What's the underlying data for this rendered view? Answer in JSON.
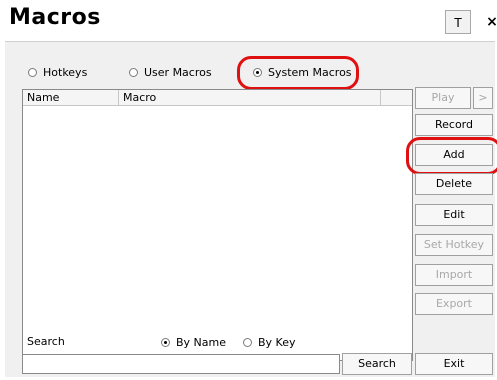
{
  "window": {
    "title": "Macros",
    "pin_label": "T",
    "close_label": "×"
  },
  "tabs": {
    "hotkeys": "Hotkeys",
    "user_macros": "User Macros",
    "system_macros": "System Macros",
    "selected": "System Macros"
  },
  "list": {
    "columns": [
      "Name",
      "Macro",
      ""
    ],
    "rows": []
  },
  "buttons": {
    "play": "Play",
    "play_more": ">",
    "record": "Record",
    "add": "Add",
    "delete": "Delete",
    "edit": "Edit",
    "set_hotkey": "Set Hotkey",
    "import": "Import",
    "export": "Export",
    "search": "Search",
    "exit": "Exit"
  },
  "search": {
    "label": "Search",
    "by_name": "By Name",
    "by_key": "By Key",
    "selected": "By Name",
    "value": ""
  },
  "colors": {
    "highlight": "#e01010"
  }
}
